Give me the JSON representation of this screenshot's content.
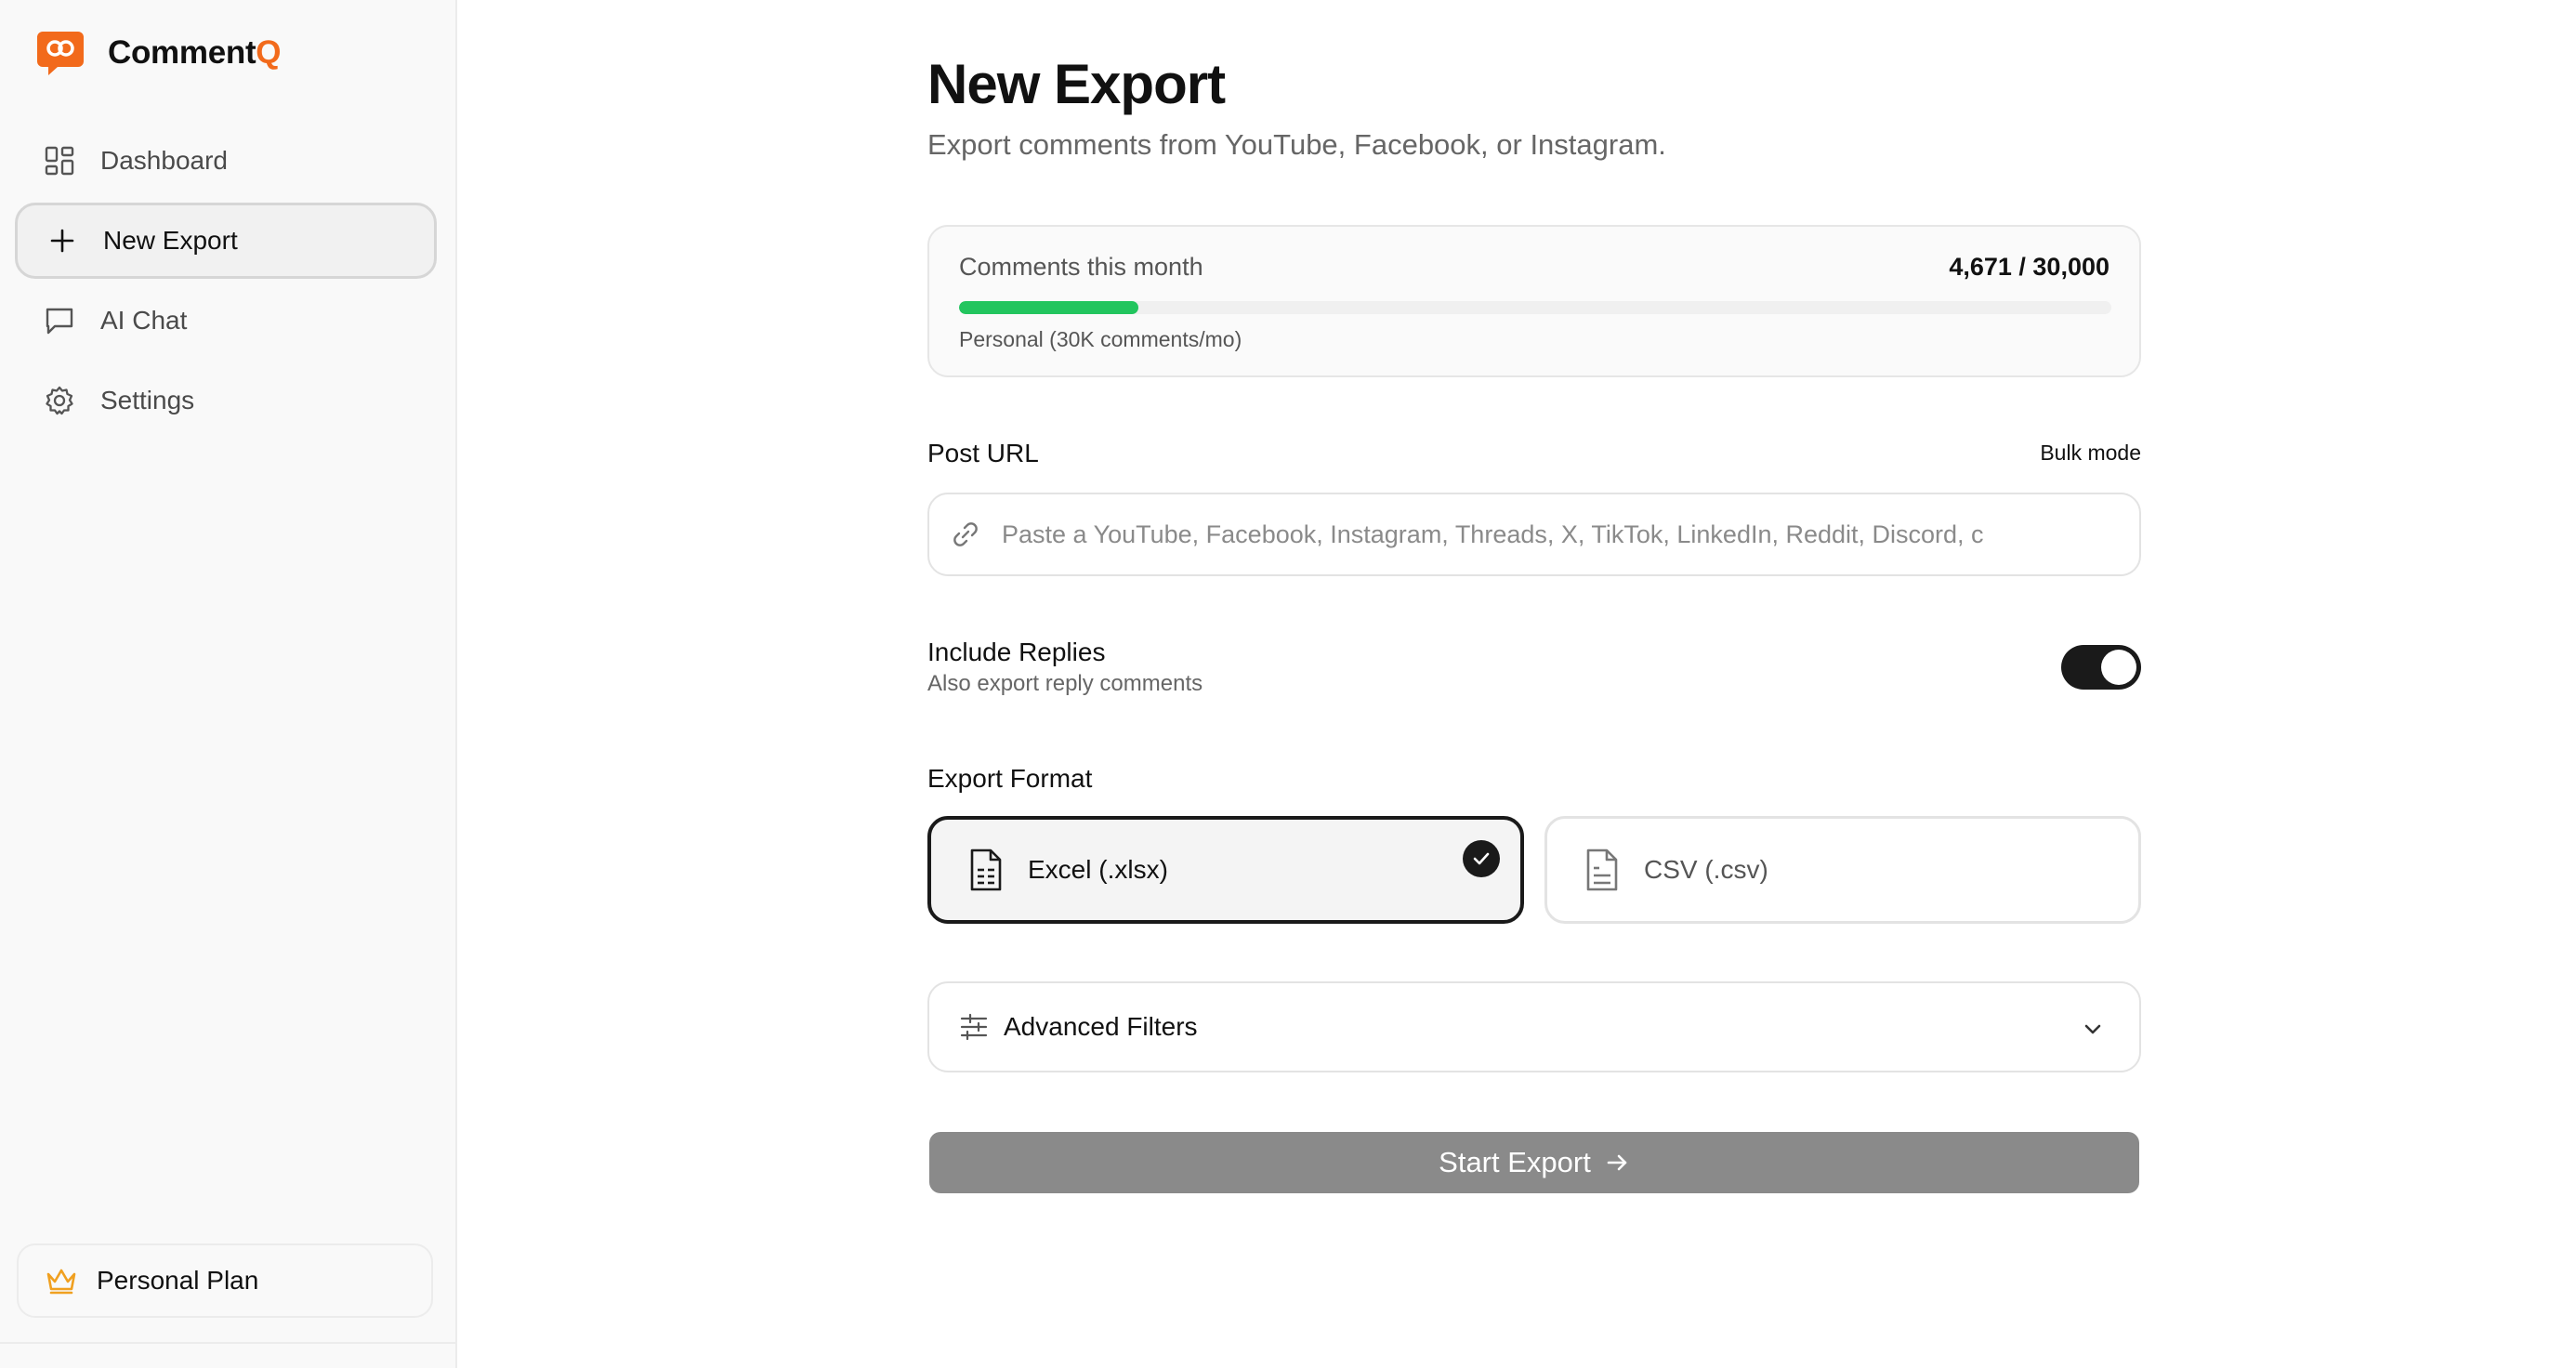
{
  "app": {
    "name_main": "Comment",
    "name_accent": "Q",
    "brand_color": "#f26a1b"
  },
  "sidebar": {
    "items": [
      {
        "label": "Dashboard",
        "icon": "grid-icon",
        "active": false
      },
      {
        "label": "New Export",
        "icon": "plus-icon",
        "active": true
      },
      {
        "label": "AI Chat",
        "icon": "chat-bubble-icon",
        "active": false
      },
      {
        "label": "Settings",
        "icon": "gear-icon",
        "active": false
      }
    ],
    "plan_label": "Personal Plan",
    "plan_icon": "crown-icon"
  },
  "page": {
    "title": "New Export",
    "subtitle": "Export comments from YouTube, Facebook, or Instagram."
  },
  "usage": {
    "label": "Comments this month",
    "count": "4,671 / 30,000",
    "used": 4671,
    "limit": 30000,
    "plan_text": "Personal (30K comments/mo)",
    "bar_color": "#22c55e"
  },
  "post_url": {
    "label": "Post URL",
    "bulk_mode": "Bulk mode",
    "placeholder": "Paste a YouTube, Facebook, Instagram, Threads, X, TikTok, LinkedIn, Reddit, Discord, c",
    "value": "",
    "icon": "link-icon"
  },
  "replies": {
    "title": "Include Replies",
    "subtitle": "Also export reply comments",
    "enabled": true
  },
  "format": {
    "label": "Export Format",
    "options": [
      {
        "label": "Excel (.xlsx)",
        "icon": "spreadsheet-file-icon",
        "selected": true
      },
      {
        "label": "CSV (.csv)",
        "icon": "text-file-icon",
        "selected": false
      }
    ]
  },
  "filters": {
    "label": "Advanced Filters",
    "icon": "sliders-icon",
    "expanded": false
  },
  "start_button": {
    "label": "Start Export",
    "icon": "arrow-right-icon"
  }
}
